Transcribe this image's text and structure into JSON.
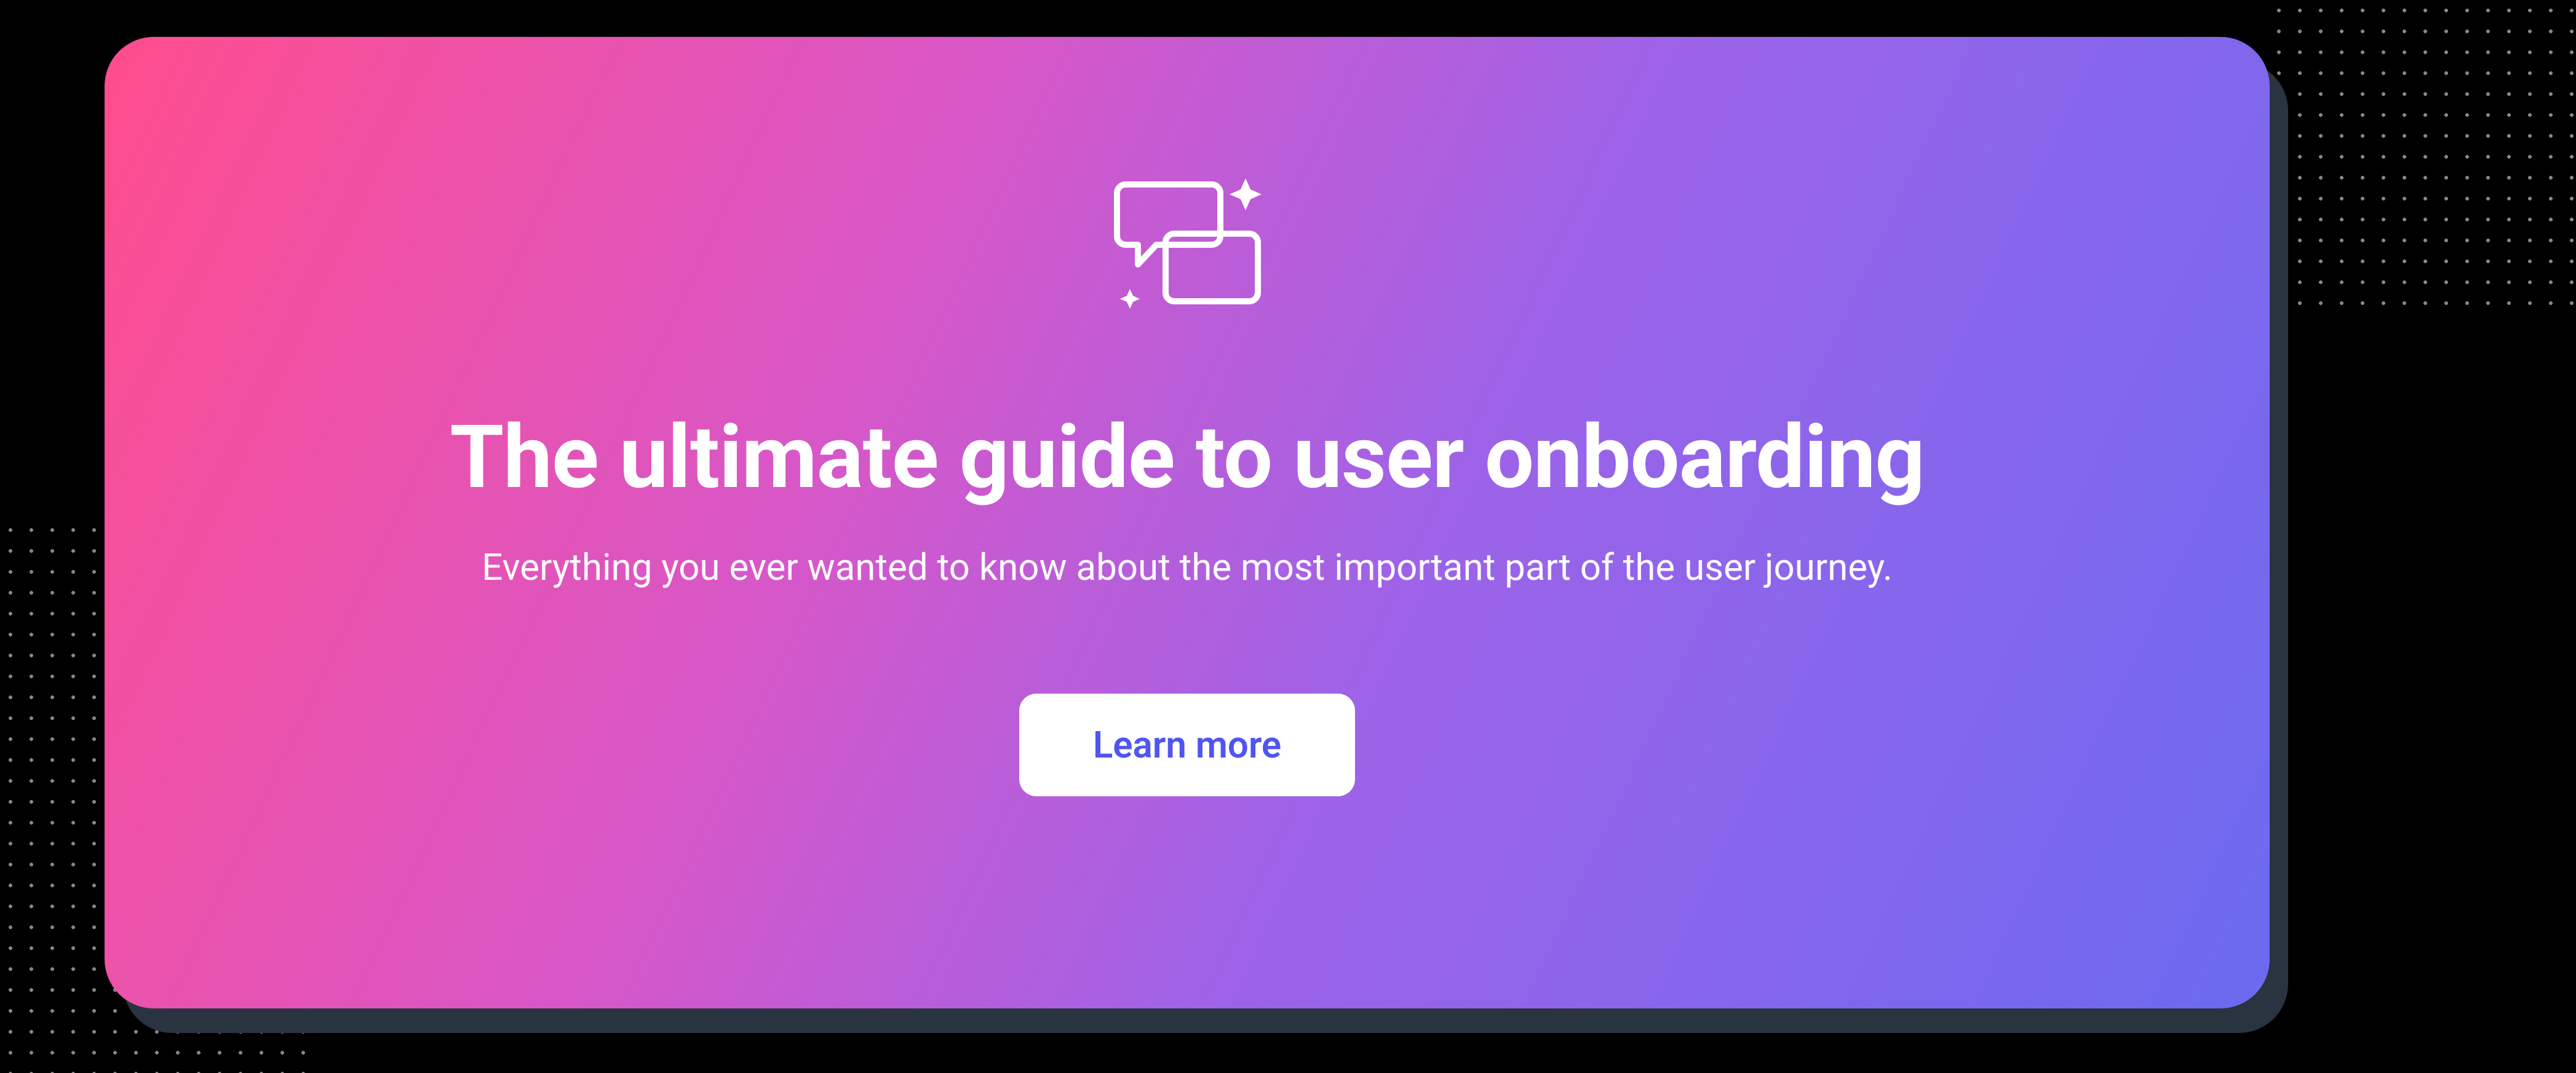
{
  "hero": {
    "title": "The ultimate guide to user onboarding",
    "subtitle": "Everything you ever wanted to know about the most important part of the user journey.",
    "cta_label": "Learn more"
  },
  "colors": {
    "gradient_start": "#ff4d8d",
    "gradient_end": "#6b6af0",
    "button_text": "#4f56f0",
    "button_bg": "#ffffff",
    "shadow_card": "#2a3340"
  }
}
